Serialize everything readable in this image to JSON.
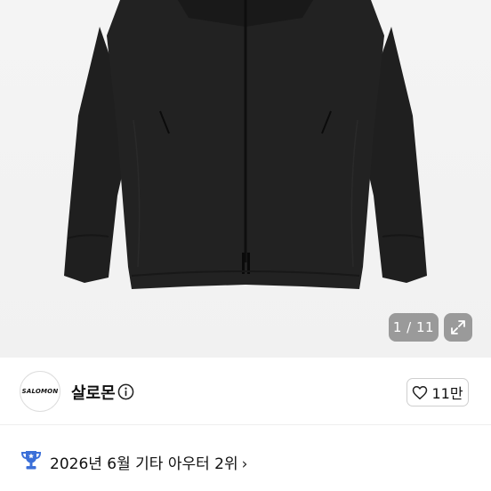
{
  "gallery": {
    "image_alt": "black salomon jacket",
    "current": "1 / 11",
    "expand_icon": "expand-icon"
  },
  "seller": {
    "avatar_text": "SALOMON",
    "name": "살로몬",
    "info_icon": "info-icon",
    "like_icon": "heart-icon",
    "like_count": "11만"
  },
  "ranking": {
    "icon": "trophy-icon",
    "text": "2026년 6월 기타 아우터 2위",
    "chevron": "›"
  },
  "colors": {
    "trophy": "#3b6fd8",
    "pager_bg": "#828282"
  }
}
